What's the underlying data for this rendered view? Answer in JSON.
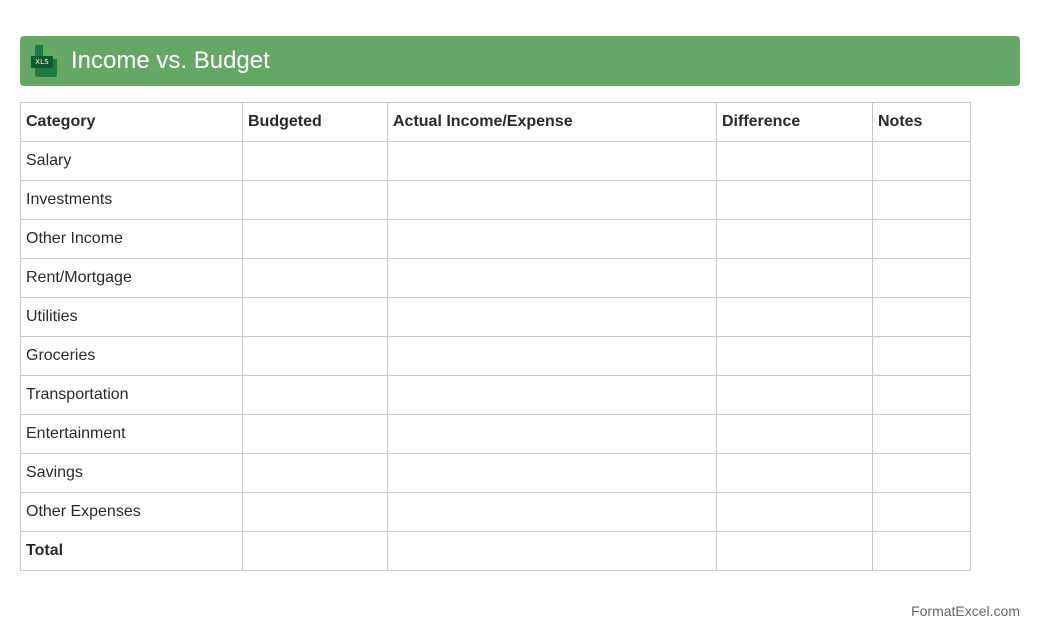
{
  "header": {
    "title": "Income vs. Budget",
    "icon": "xls-file-icon",
    "icon_tag": "XLS",
    "color": "#65a866"
  },
  "table": {
    "columns": [
      "Category",
      "Budgeted",
      "Actual Income/Expense",
      "Difference",
      "Notes"
    ],
    "rows": [
      {
        "category": "Salary",
        "budgeted": "",
        "actual": "",
        "difference": "",
        "notes": ""
      },
      {
        "category": "Investments",
        "budgeted": "",
        "actual": "",
        "difference": "",
        "notes": ""
      },
      {
        "category": "Other Income",
        "budgeted": "",
        "actual": "",
        "difference": "",
        "notes": ""
      },
      {
        "category": "Rent/Mortgage",
        "budgeted": "",
        "actual": "",
        "difference": "",
        "notes": ""
      },
      {
        "category": "Utilities",
        "budgeted": "",
        "actual": "",
        "difference": "",
        "notes": ""
      },
      {
        "category": "Groceries",
        "budgeted": "",
        "actual": "",
        "difference": "",
        "notes": ""
      },
      {
        "category": "Transportation",
        "budgeted": "",
        "actual": "",
        "difference": "",
        "notes": ""
      },
      {
        "category": "Entertainment",
        "budgeted": "",
        "actual": "",
        "difference": "",
        "notes": ""
      },
      {
        "category": "Savings",
        "budgeted": "",
        "actual": "",
        "difference": "",
        "notes": ""
      },
      {
        "category": "Other Expenses",
        "budgeted": "",
        "actual": "",
        "difference": "",
        "notes": ""
      },
      {
        "category": "Total",
        "budgeted": "",
        "actual": "",
        "difference": "",
        "notes": ""
      }
    ]
  },
  "footer": {
    "credit": "FormatExcel.com"
  }
}
